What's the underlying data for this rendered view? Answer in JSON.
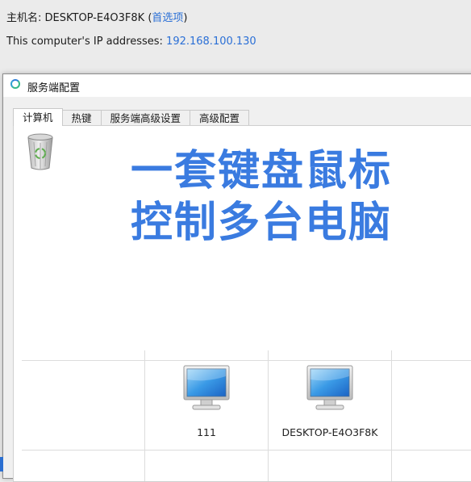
{
  "header": {
    "hostname_label": "主机名: ",
    "hostname": "DESKTOP-E4O3F8K",
    "paren_open": " (",
    "prefs_link": "首选项",
    "paren_close": ")",
    "ip_label": "This computer's IP addresses: ",
    "ip_address": "192.168.100.130"
  },
  "window": {
    "title": "服务端配置"
  },
  "tabs": [
    {
      "label": "计算机"
    },
    {
      "label": "热键"
    },
    {
      "label": "服务端高级设置"
    },
    {
      "label": "高级配置"
    }
  ],
  "banner": {
    "line1": "一套键盘鼠标",
    "line2": "控制多台电脑"
  },
  "screens": [
    {
      "name": "111"
    },
    {
      "name": "DESKTOP-E4O3F8K"
    }
  ],
  "colors": {
    "accent": "#2a6fd6",
    "banner": "#3a7be0"
  }
}
